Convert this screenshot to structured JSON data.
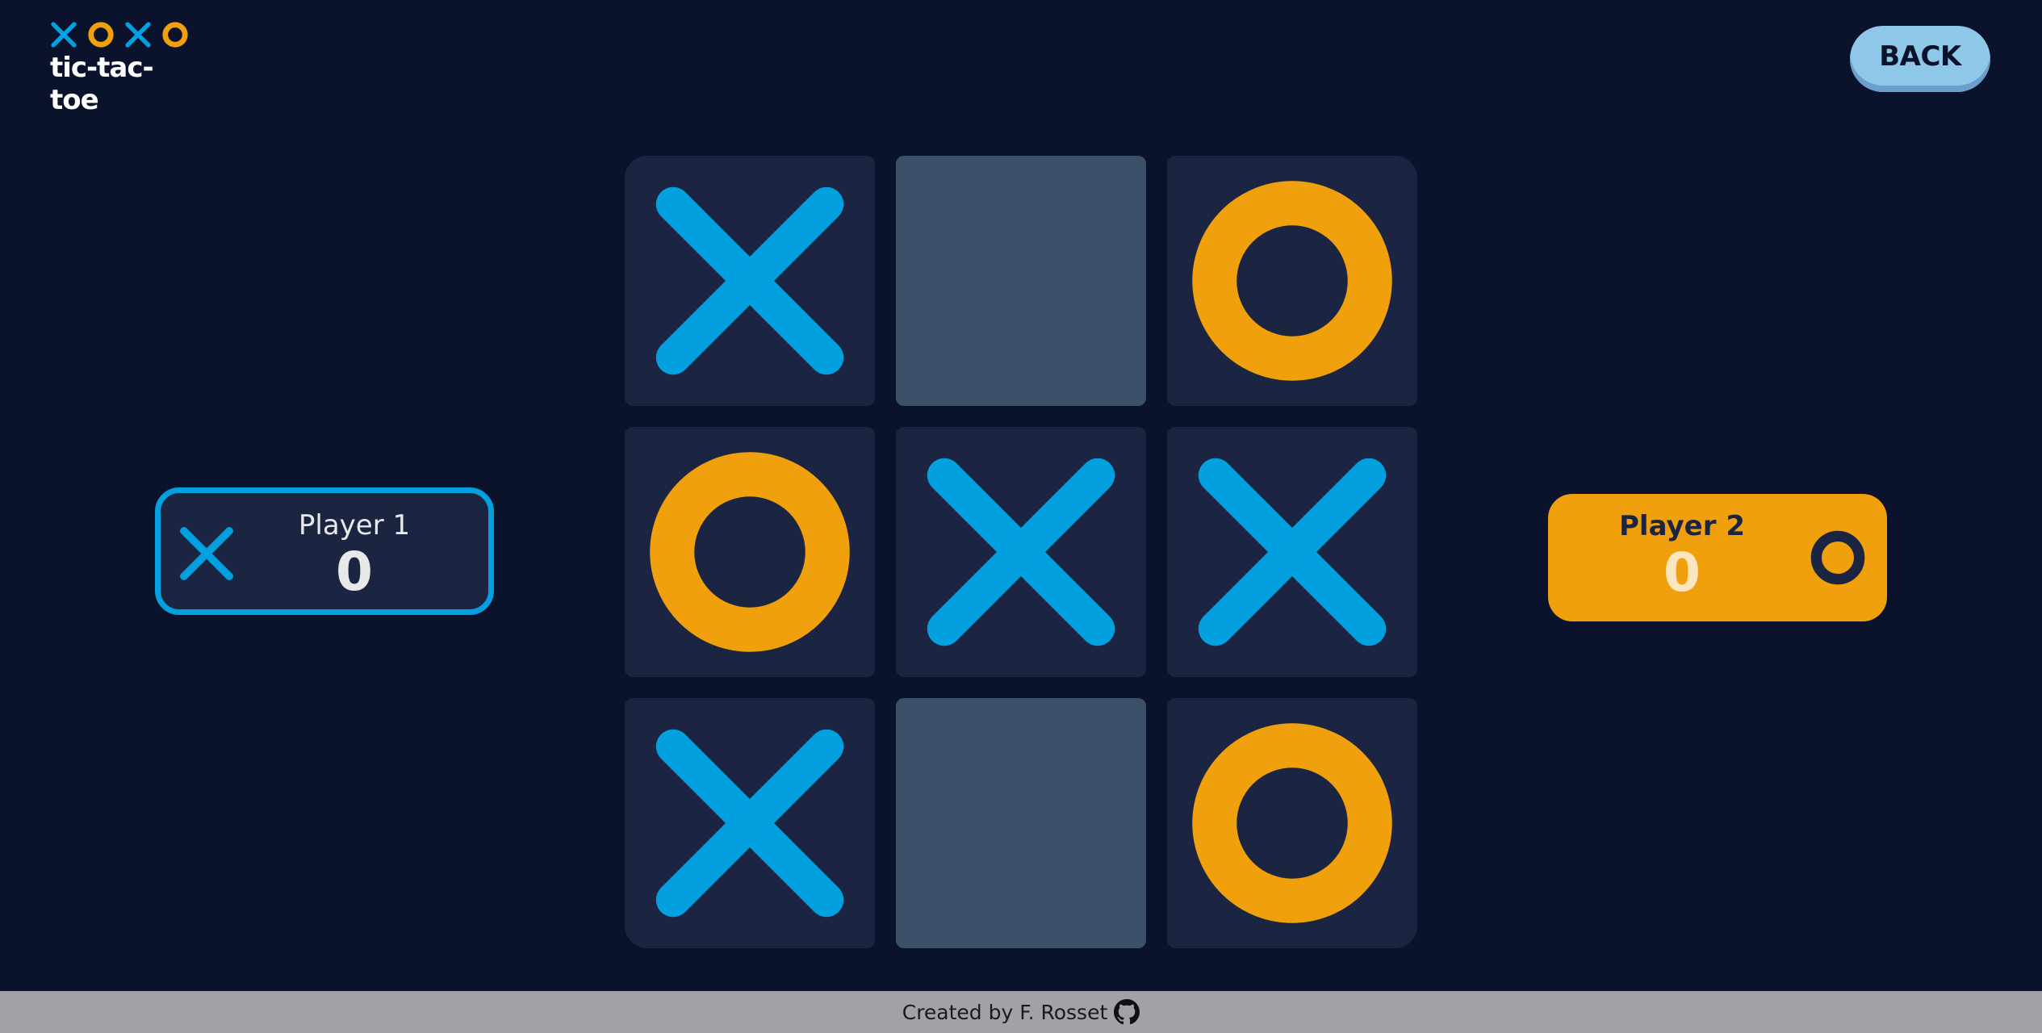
{
  "logo": {
    "marks": [
      "x",
      "o",
      "x",
      "o"
    ],
    "text": "tic-tac-toe"
  },
  "header": {
    "back_label": "BACK"
  },
  "board": {
    "cells": [
      "x",
      "",
      "o",
      "o",
      "x",
      "x",
      "x",
      "",
      "o"
    ]
  },
  "players": [
    {
      "name": "Player 1",
      "score": "0",
      "mark": "x",
      "active": true
    },
    {
      "name": "Player 2",
      "score": "0",
      "mark": "o",
      "active": false
    }
  ],
  "footer": {
    "text": "Created by F. Rosset",
    "icon": "github-icon"
  },
  "colors": {
    "background": "#0b122b",
    "cell": "#1b2440",
    "empty_cell": "#3b5069",
    "x": "#03a0e0",
    "o": "#f0a00c",
    "back_button": "#8ec7e8",
    "footer": "#a0a2a8"
  }
}
